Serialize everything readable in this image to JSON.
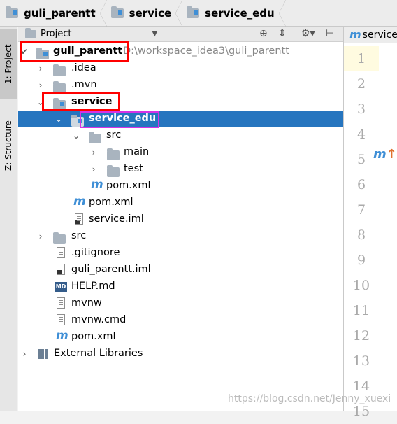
{
  "breadcrumb": {
    "items": [
      "guli_parentt",
      "service",
      "service_edu"
    ]
  },
  "stripe": {
    "project_label": "1: Project",
    "structure_label": "Z: Structure"
  },
  "panel": {
    "title": "Project",
    "dropdown_icon": "chevron-down-icon",
    "tools": [
      "crosshair-icon",
      "collapse-icon",
      "gear-icon",
      "hide-icon"
    ]
  },
  "tree": {
    "root_label": "guli_parentt",
    "root_path": "D:\\workspace_idea3\\guli_parentt",
    "items": [
      ".idea",
      ".mvn",
      "service",
      "service_edu",
      "src",
      "main",
      "test",
      "pom.xml",
      "pom.xml",
      "service.iml",
      "src",
      ".gitignore",
      "guli_parentt.iml",
      "HELP.md",
      "mvnw",
      "mvnw.cmd",
      "pom.xml",
      "External Libraries"
    ],
    "selected": "service_edu",
    "md_badge": "MD"
  },
  "editor": {
    "tab_label": "service",
    "line_numbers": [
      "1",
      "2",
      "3",
      "4",
      "5",
      "6",
      "7",
      "8",
      "9",
      "10",
      "11",
      "12",
      "13",
      "14",
      "15"
    ]
  },
  "watermark": "https://blog.csdn.net/Jenny_xuexi"
}
